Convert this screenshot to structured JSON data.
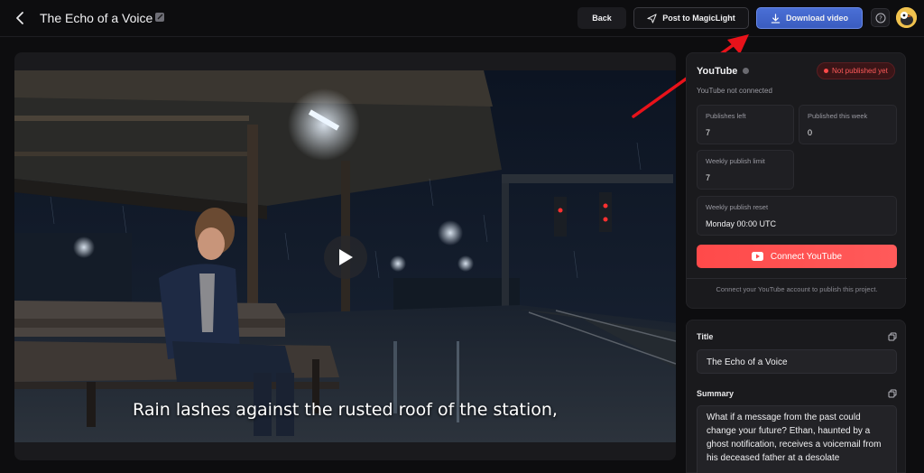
{
  "header": {
    "title": "The Echo of a Voice",
    "back_label": "Back",
    "post_label": "Post to MagicLight",
    "download_label": "Download video"
  },
  "video": {
    "caption": "Rain lashes against the rusted roof of the station,"
  },
  "youtube": {
    "title": "YouTube",
    "status": "Not published yet",
    "connection": "YouTube not connected",
    "stats": {
      "publishes_left_label": "Publishes left",
      "publishes_left": "7",
      "published_week_label": "Published this week",
      "published_week": "0",
      "weekly_limit_label": "Weekly publish limit",
      "weekly_limit": "7",
      "weekly_reset_label": "Weekly publish reset",
      "weekly_reset": "Monday 00:00 UTC"
    },
    "connect_label": "Connect YouTube",
    "help_text": "Connect your YouTube account to publish this project."
  },
  "meta": {
    "title_label": "Title",
    "title_value": "The Echo of a Voice",
    "summary_label": "Summary",
    "summary_value": "What if a message from the past could change your future? Ethan, haunted by a ghost notification, receives a voicemail from his deceased father at a desolate"
  },
  "colors": {
    "accent_blue": "#4a6fd6",
    "youtube_red": "#ff4a4a",
    "annotation_red": "#e8121a"
  }
}
